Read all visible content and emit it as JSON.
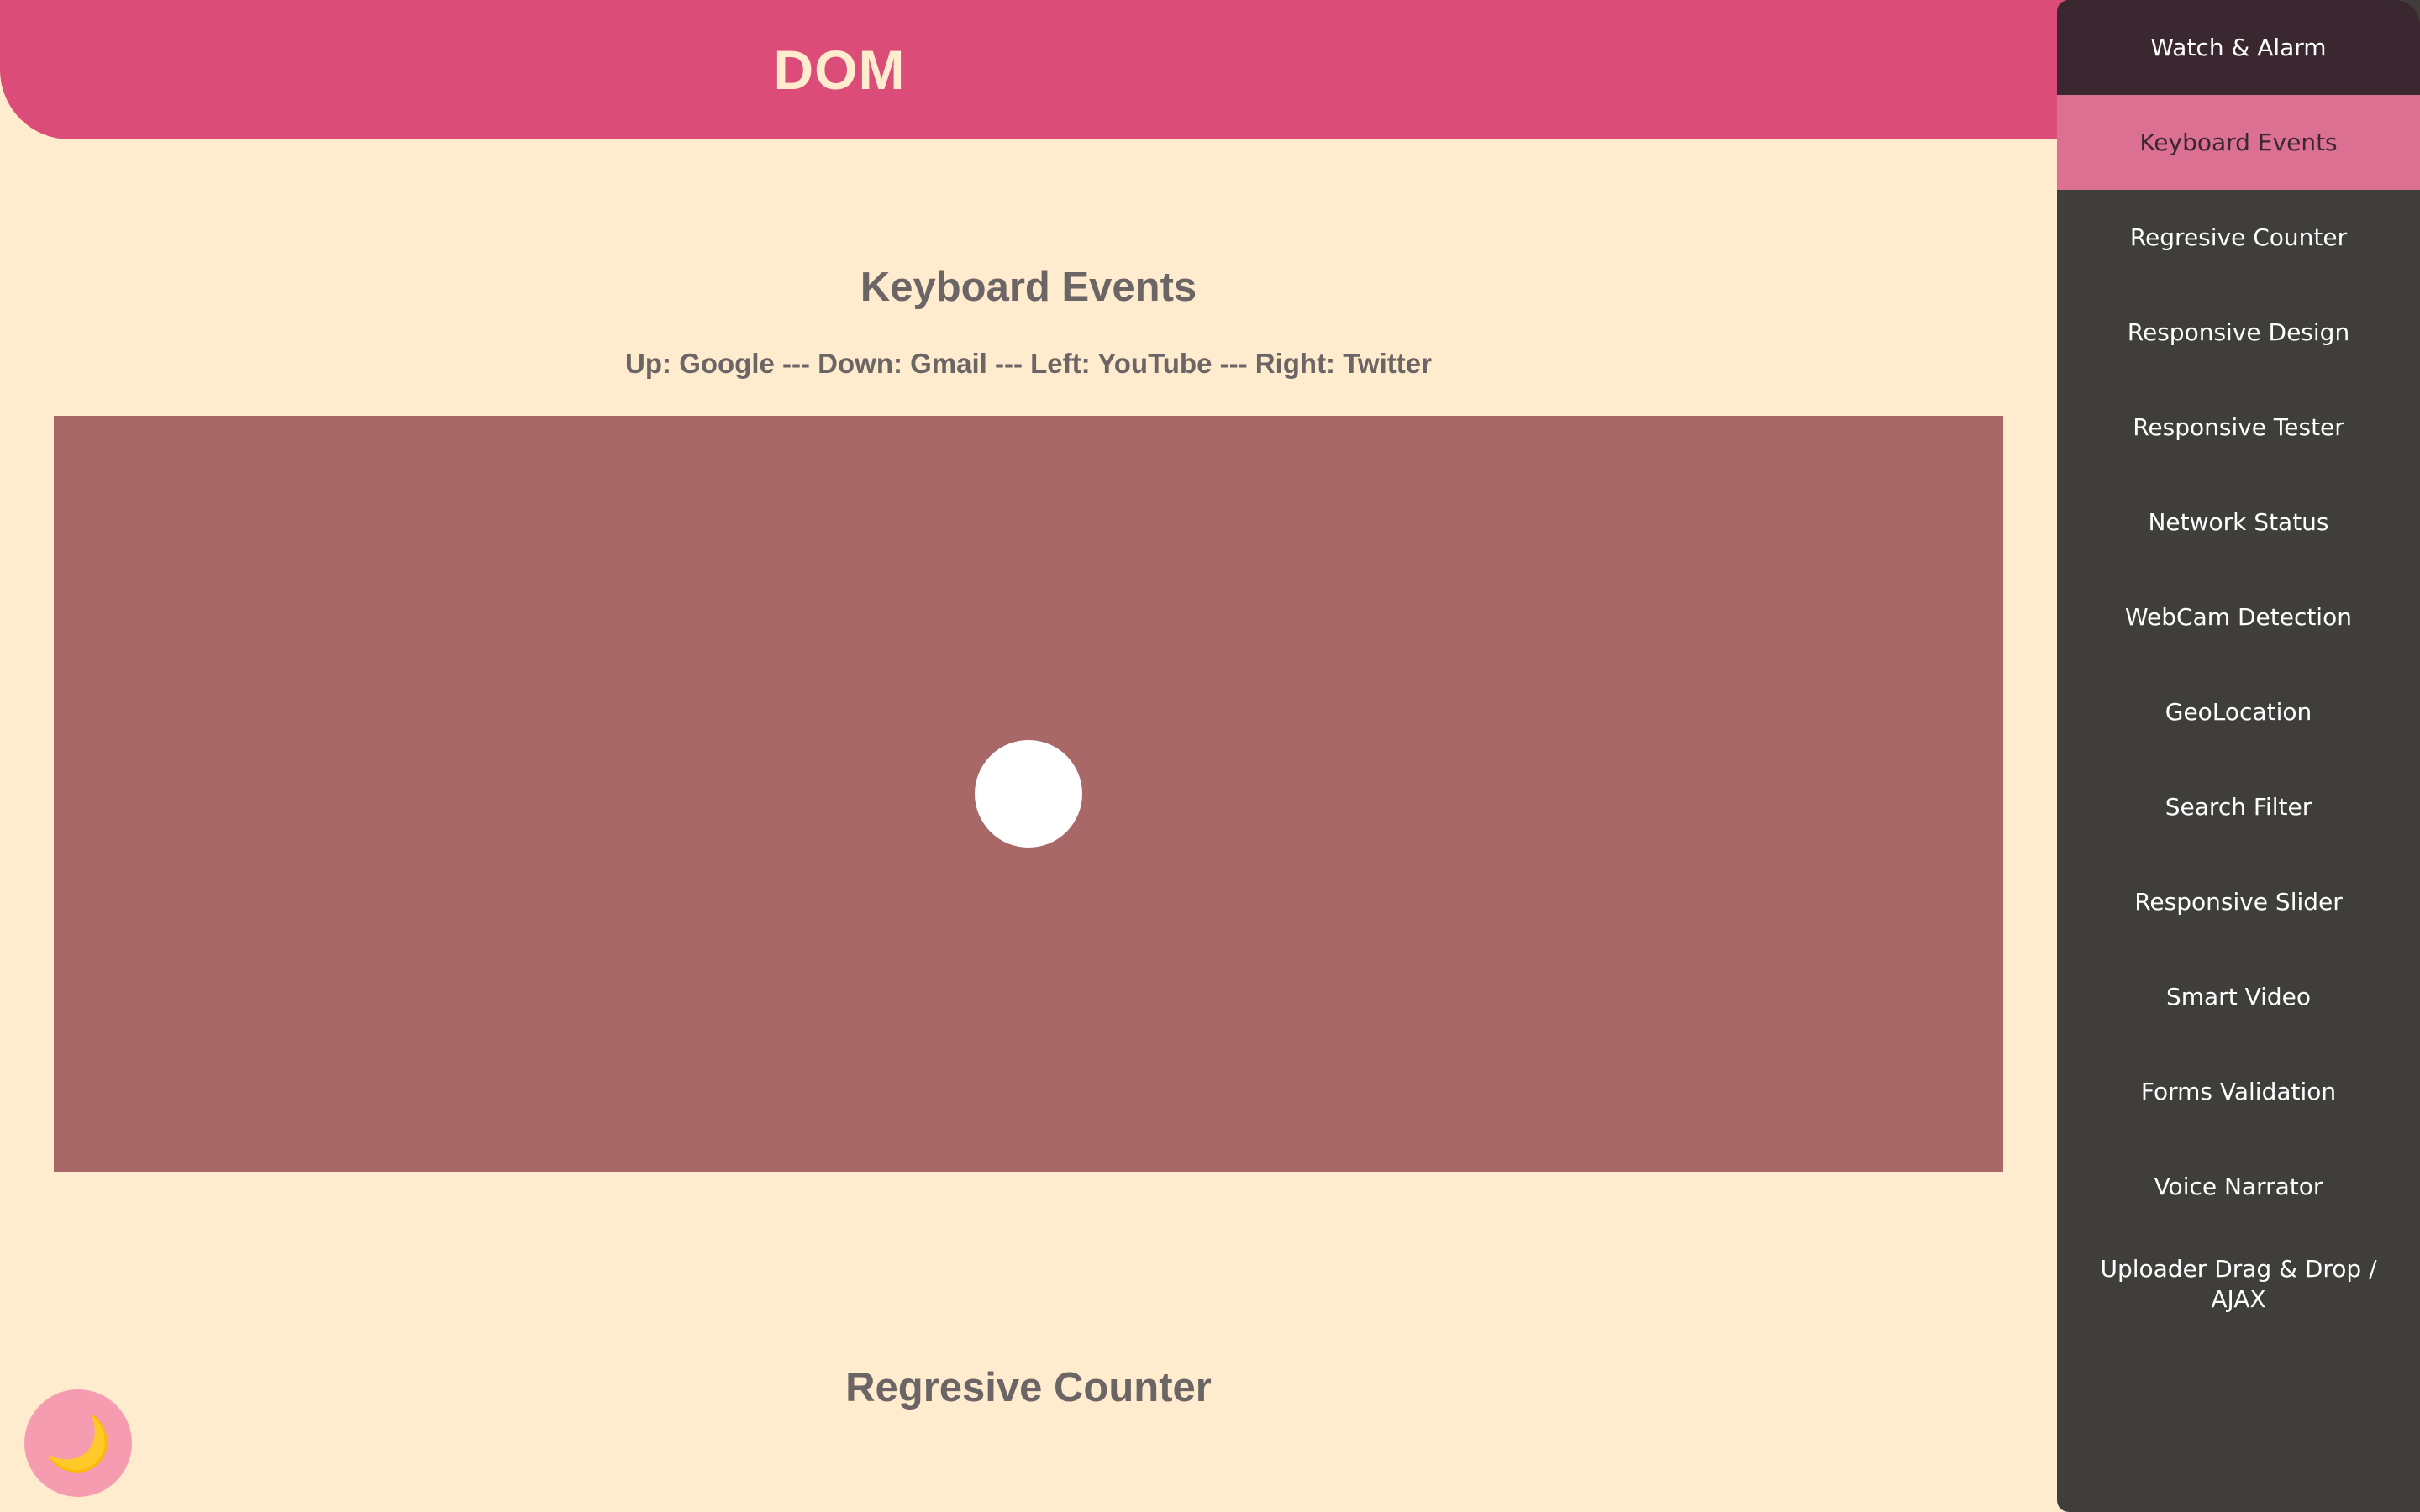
{
  "header": {
    "title": "DOM"
  },
  "keyboard_section": {
    "title": "Keyboard Events",
    "instructions": "Up: Google --- Down: Gmail --- Left: YouTube --- Right: Twitter"
  },
  "counter_section": {
    "title": "Regresive Counter"
  },
  "menu": {
    "items": [
      {
        "label": "Watch & Alarm"
      },
      {
        "label": "Keyboard Events",
        "active": true
      },
      {
        "label": "Regresive Counter"
      },
      {
        "label": "Responsive Design"
      },
      {
        "label": "Responsive Tester"
      },
      {
        "label": "Network Status"
      },
      {
        "label": "WebCam Detection"
      },
      {
        "label": "GeoLocation"
      },
      {
        "label": "Search Filter"
      },
      {
        "label": "Responsive Slider"
      },
      {
        "label": "Smart Video"
      },
      {
        "label": "Forms Validation"
      },
      {
        "label": "Voice Narrator"
      },
      {
        "label": "Uploader Drag & Drop / AJAX"
      }
    ]
  },
  "theme_toggle": {
    "icon": "moon-icon",
    "glyph": "🌙"
  },
  "colors": {
    "background": "#ffebcd",
    "header": "#db4c79",
    "stage": "#a86868",
    "menu": "#403e3b",
    "menu_active": "#dc7092",
    "toggle": "#f59cb0"
  }
}
